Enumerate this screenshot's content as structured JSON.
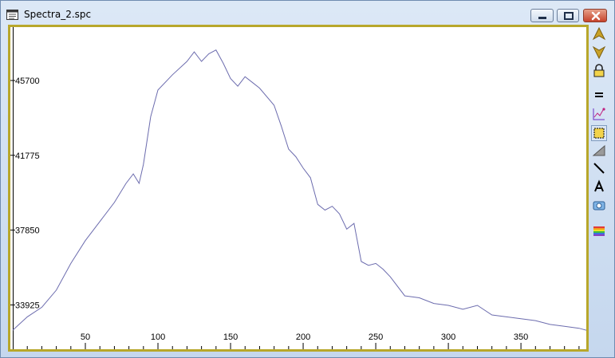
{
  "window": {
    "title": "Spectra_2.spc",
    "buttons": {
      "minimize": "minimize",
      "maximize": "maximize",
      "close": "close"
    }
  },
  "toolbar": {
    "items": [
      {
        "name": "scroll-up-icon"
      },
      {
        "name": "scroll-down-icon"
      },
      {
        "name": "lock-icon"
      },
      {
        "name": "equals-icon"
      },
      {
        "name": "peak-icon"
      },
      {
        "name": "select-box-icon"
      },
      {
        "name": "fill-icon"
      },
      {
        "name": "line-tool-icon"
      },
      {
        "name": "text-tool-icon"
      },
      {
        "name": "camera-icon"
      },
      {
        "name": "rainbow-icon"
      }
    ]
  },
  "colors": {
    "frame": "#b8a72b",
    "trace": "#6c6cae",
    "background": "#ffffff"
  },
  "chart_data": {
    "type": "line",
    "x_ticks": [
      "50",
      "100",
      "150",
      "200",
      "250",
      "300",
      "350"
    ],
    "y_ticks": [
      "33925",
      "37850",
      "41775",
      "45700"
    ],
    "xlim": [
      0,
      395
    ],
    "ylim": [
      31600,
      48500
    ],
    "grid": false,
    "series": [
      {
        "x": [
          0,
          10,
          20,
          30,
          40,
          50,
          60,
          70,
          78,
          83,
          87,
          90,
          95,
          100,
          110,
          120,
          125,
          130,
          135,
          140,
          145,
          150,
          155,
          160,
          165,
          170,
          180,
          185,
          190,
          195,
          200,
          205,
          210,
          215,
          220,
          225,
          230,
          235,
          240,
          245,
          250,
          255,
          260,
          270,
          280,
          290,
          300,
          310,
          320,
          330,
          340,
          350,
          360,
          370,
          380,
          390,
          395
        ],
        "y": [
          32600,
          33300,
          33800,
          34700,
          36100,
          37300,
          38300,
          39300,
          40300,
          40800,
          40300,
          41300,
          43800,
          45200,
          46000,
          46700,
          47200,
          46700,
          47100,
          47300,
          46600,
          45800,
          45400,
          45900,
          45600,
          45300,
          44400,
          43300,
          42100,
          41700,
          41100,
          40600,
          39200,
          38900,
          39100,
          38700,
          37900,
          38200,
          36200,
          36000,
          36100,
          35800,
          35400,
          34400,
          34300,
          34000,
          33900,
          33700,
          33900,
          33400,
          33300,
          33200,
          33100,
          32900,
          32800,
          32700,
          32600
        ]
      }
    ]
  }
}
